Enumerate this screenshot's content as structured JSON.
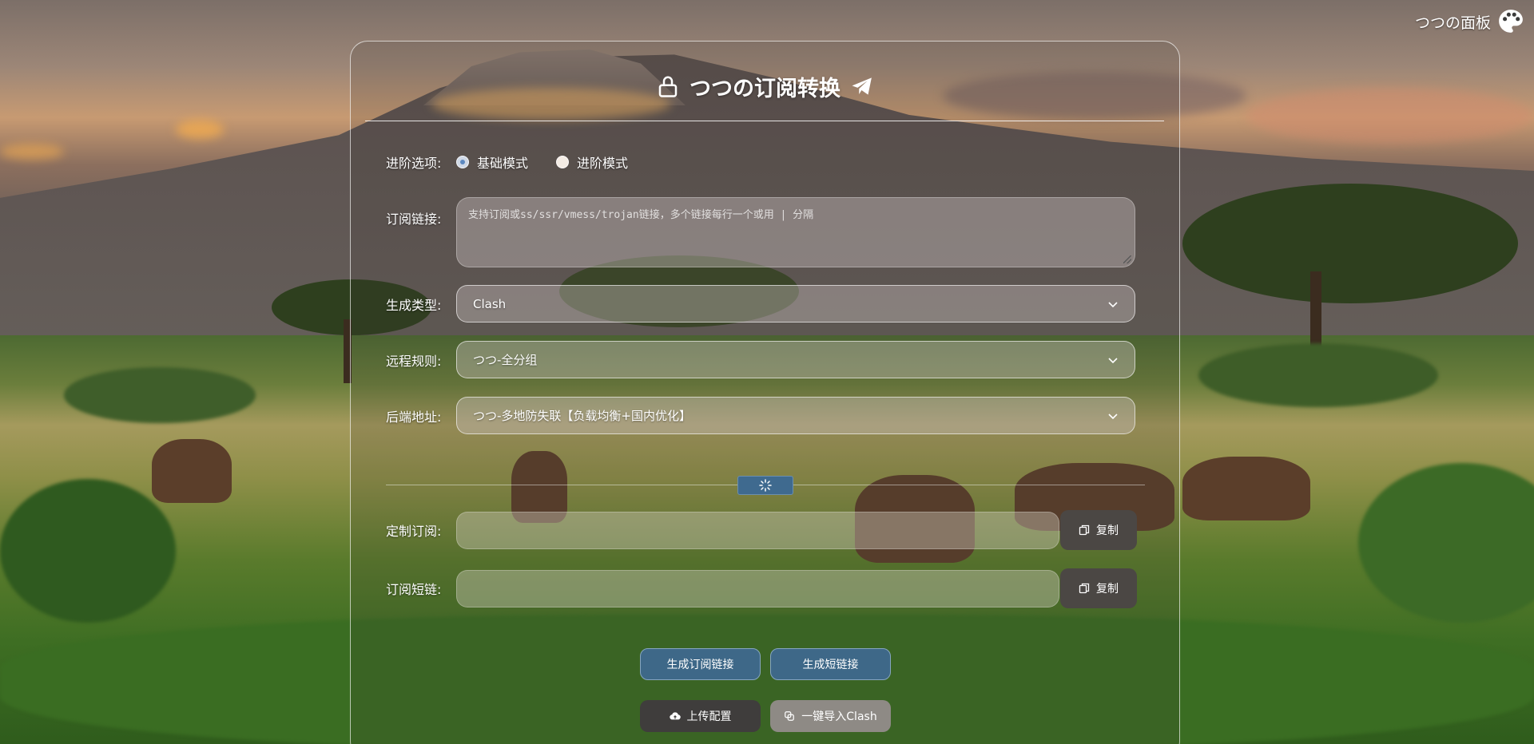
{
  "brand": {
    "title": "つつの面板",
    "icon": "palette-icon"
  },
  "header": {
    "title": "つつの订阅转换",
    "lock_icon": "lock-icon",
    "telegram_icon": "telegram-icon"
  },
  "mode": {
    "label": "进阶选项:",
    "options": [
      {
        "label": "基础模式",
        "selected": true
      },
      {
        "label": "进阶模式",
        "selected": false
      }
    ]
  },
  "subscription": {
    "label": "订阅链接:",
    "placeholder": "支持订阅或ss/ssr/vmess/trojan链接，多个链接每行一个或用 | 分隔",
    "value": ""
  },
  "target": {
    "label": "生成类型:",
    "value": "Clash"
  },
  "remote_rules": {
    "label": "远程规则:",
    "value": "つつ-全分组"
  },
  "backend": {
    "label": "后端地址:",
    "value": "つつ-多地防失联【负载均衡+国内优化】"
  },
  "custom_sub": {
    "label": "定制订阅:",
    "value": "",
    "copy_label": "复制"
  },
  "short_link": {
    "label": "订阅短链:",
    "value": "",
    "copy_label": "复制"
  },
  "actions": {
    "generate_sub": "生成订阅链接",
    "generate_short": "生成短链接",
    "upload_config": "上传配置",
    "import_clash": "一键导入Clash"
  },
  "colors": {
    "accent_blue": "#3e6888",
    "dark_button": "#3f3d3c",
    "gray_button": "#8e8a85"
  }
}
